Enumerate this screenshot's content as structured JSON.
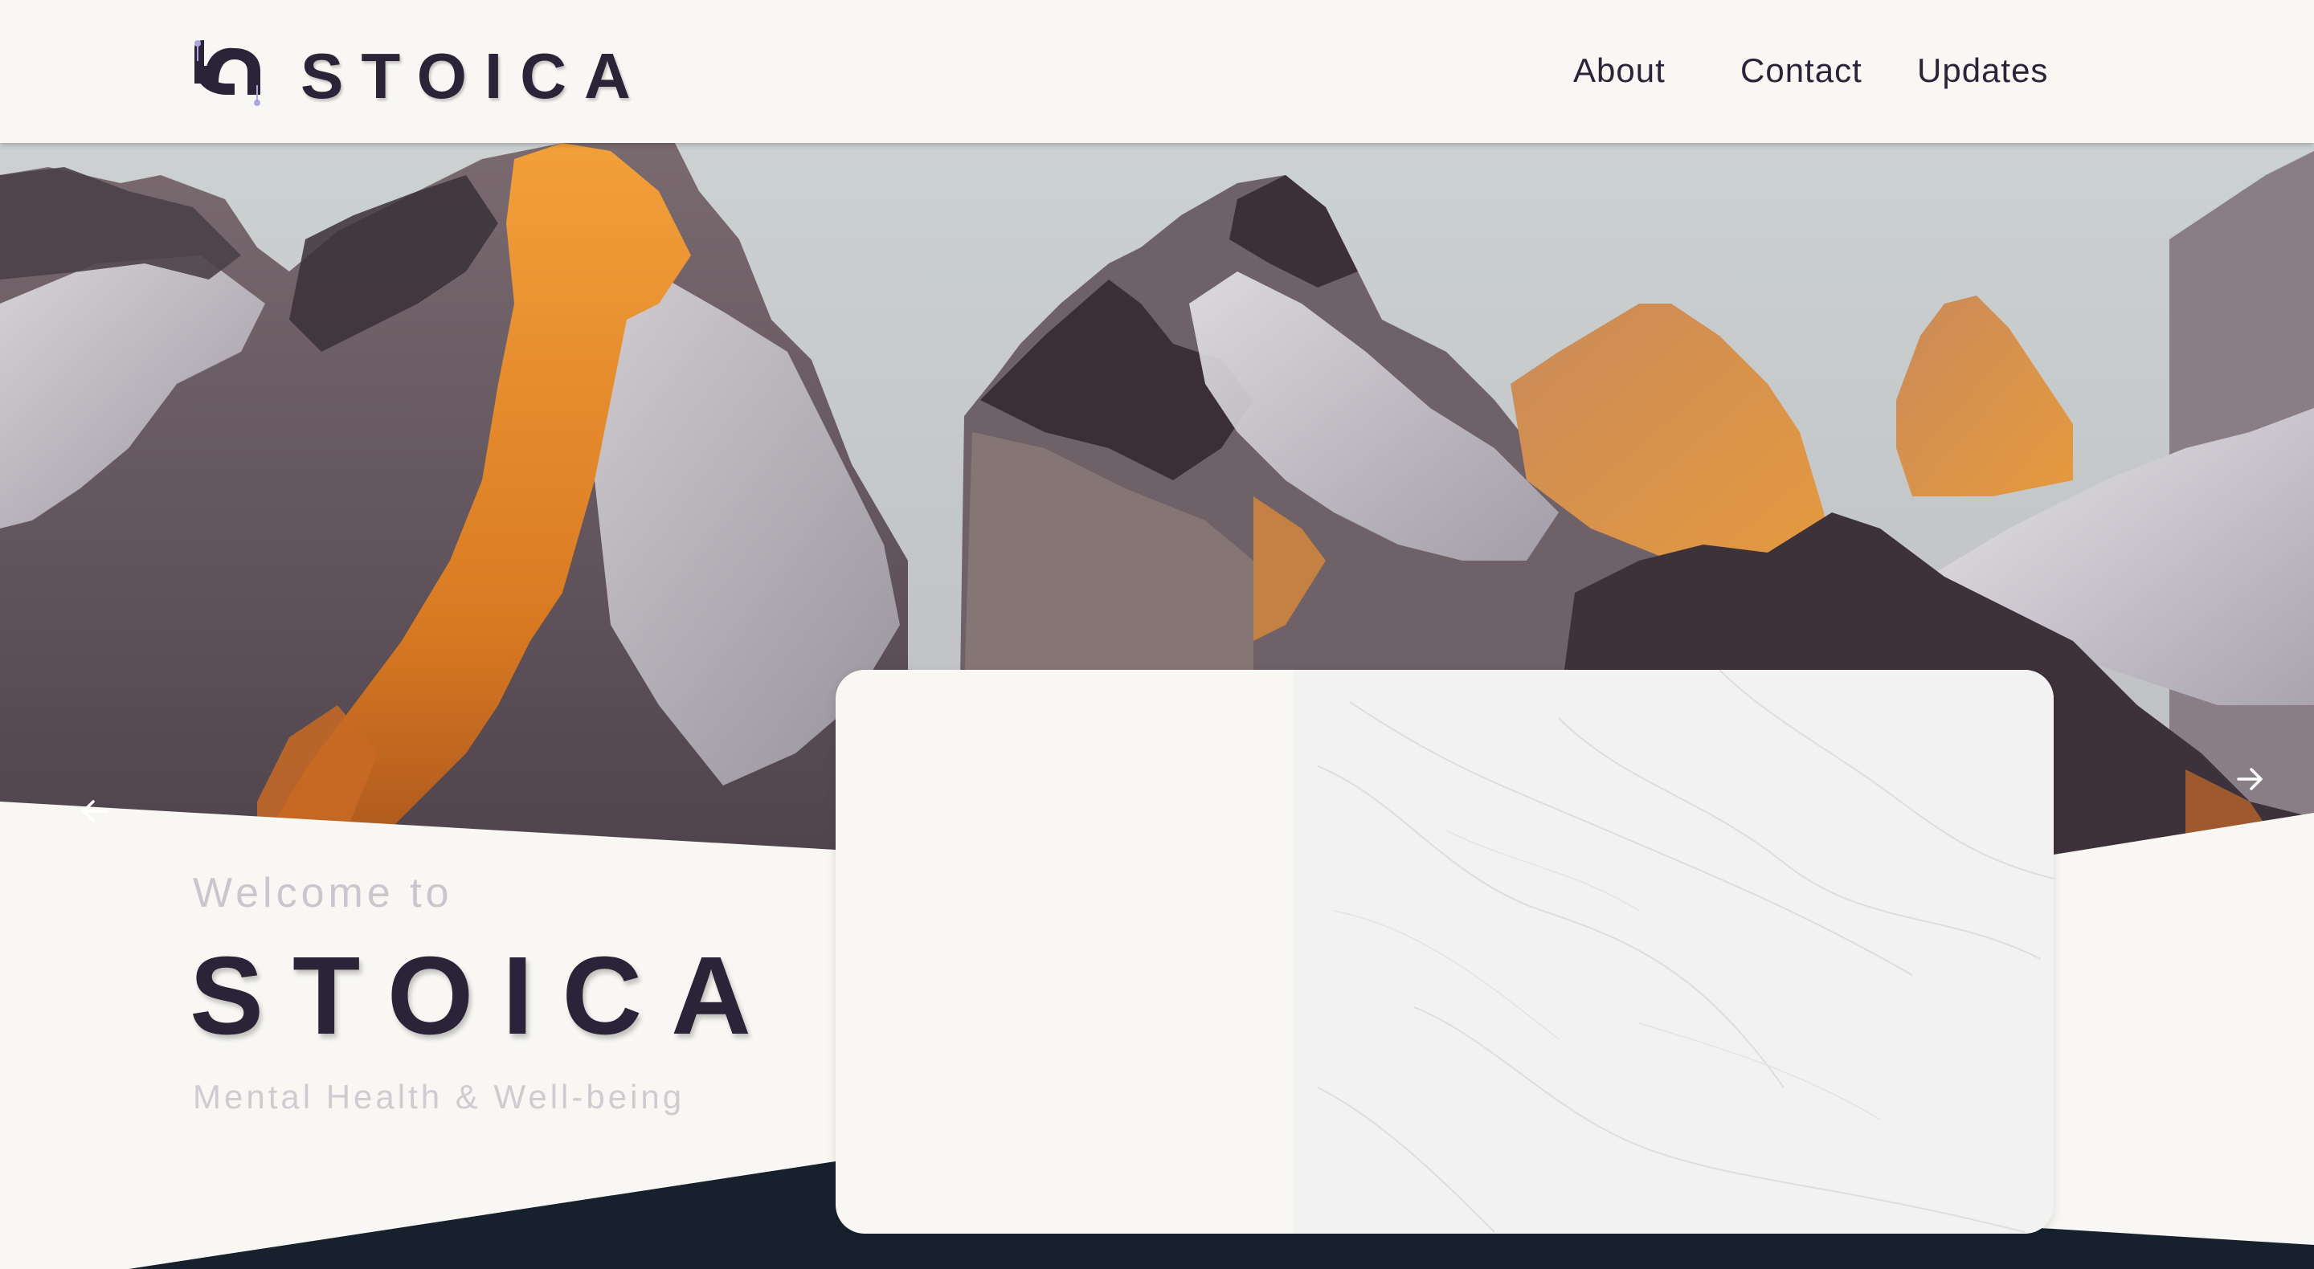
{
  "header": {
    "logo_text": "STOICA",
    "logo_icon": "stoica-logo-icon",
    "nav": [
      {
        "label": "About"
      },
      {
        "label": "Contact"
      },
      {
        "label": "Updates"
      }
    ]
  },
  "hero": {
    "prev_icon": "arrow-left-icon",
    "next_icon": "arrow-right-icon"
  },
  "intro": {
    "welcome": "Welcome to",
    "brand": "STOICA",
    "tagline": "Mental Health & Well-being"
  },
  "colors": {
    "brand_dark": "#2b2438",
    "background": "#f8f7f3",
    "footer_navy": "#17212e",
    "accent_orange": "#e58a2e"
  }
}
